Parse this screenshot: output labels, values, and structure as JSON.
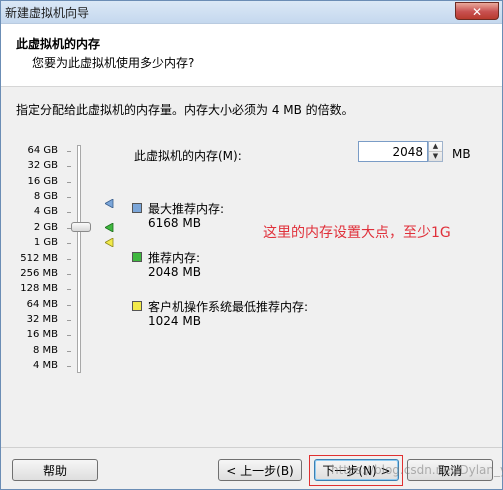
{
  "window": {
    "title": "新建虚拟机向导",
    "close_symbol": "✕"
  },
  "header": {
    "title": "此虚拟机的内存",
    "subtitle": "您要为此虚拟机使用多少内存?"
  },
  "instruction": "指定分配给此虚拟机的内存量。内存大小必须为 4 MB 的倍数。",
  "scale": [
    "64 GB",
    "32 GB",
    "16 GB",
    "8 GB",
    "4 GB",
    "2 GB",
    "1 GB",
    "512 MB",
    "256 MB",
    "128 MB",
    "64 MB",
    "32 MB",
    "16 MB",
    "8 MB",
    "4 MB"
  ],
  "memory": {
    "label": "此虚拟机的内存(M):",
    "value": "2048",
    "unit": "MB"
  },
  "legend": [
    {
      "title": "最大推荐内存:",
      "value": "6168 MB",
      "color": "#7ba6d9"
    },
    {
      "title": "推荐内存:",
      "value": "2048 MB",
      "color": "#3fb83f"
    },
    {
      "title": "客户机操作系统最低推荐内存:",
      "value": "1024 MB",
      "color": "#f2ea4a"
    }
  ],
  "annotation": "这里的内存设置大点，至少1G",
  "buttons": {
    "help": "帮助",
    "back": "< 上一步(B)",
    "next": "下一步(N) >",
    "cancel": "取消"
  },
  "watermark": "https://blog.csdn.net/Dylan_ya"
}
